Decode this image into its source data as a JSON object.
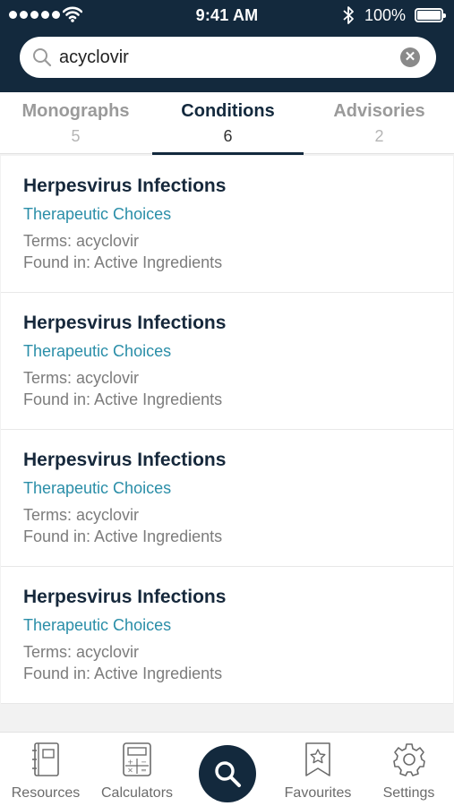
{
  "status_bar": {
    "time": "9:41 AM",
    "battery": "100%"
  },
  "search": {
    "value": "acyclovir",
    "placeholder": ""
  },
  "tabs": [
    {
      "label": "Monographs",
      "count": "5",
      "active": false
    },
    {
      "label": "Conditions",
      "count": "6",
      "active": true
    },
    {
      "label": "Advisories",
      "count": "2",
      "active": false
    }
  ],
  "results": [
    {
      "title": "Herpesvirus Infections",
      "category": "Therapeutic Choices",
      "terms": "Terms: acyclovir",
      "found_in": "Found in: Active Ingredients"
    },
    {
      "title": "Herpesvirus Infections",
      "category": "Therapeutic Choices",
      "terms": "Terms: acyclovir",
      "found_in": "Found in: Active Ingredients"
    },
    {
      "title": "Herpesvirus Infections",
      "category": "Therapeutic Choices",
      "terms": "Terms: acyclovir",
      "found_in": "Found in: Active Ingredients"
    },
    {
      "title": "Herpesvirus Infections",
      "category": "Therapeutic Choices",
      "terms": "Terms: acyclovir",
      "found_in": "Found in: Active Ingredients"
    }
  ],
  "bottom_nav": [
    {
      "label": "Resources",
      "icon": "notebook-icon"
    },
    {
      "label": "Calculators",
      "icon": "calculator-icon"
    },
    {
      "label": "",
      "icon": "search-icon"
    },
    {
      "label": "Favourites",
      "icon": "bookmark-star-icon"
    },
    {
      "label": "Settings",
      "icon": "gear-icon"
    }
  ],
  "colors": {
    "navy": "#13293d",
    "link": "#2a8ea8"
  }
}
